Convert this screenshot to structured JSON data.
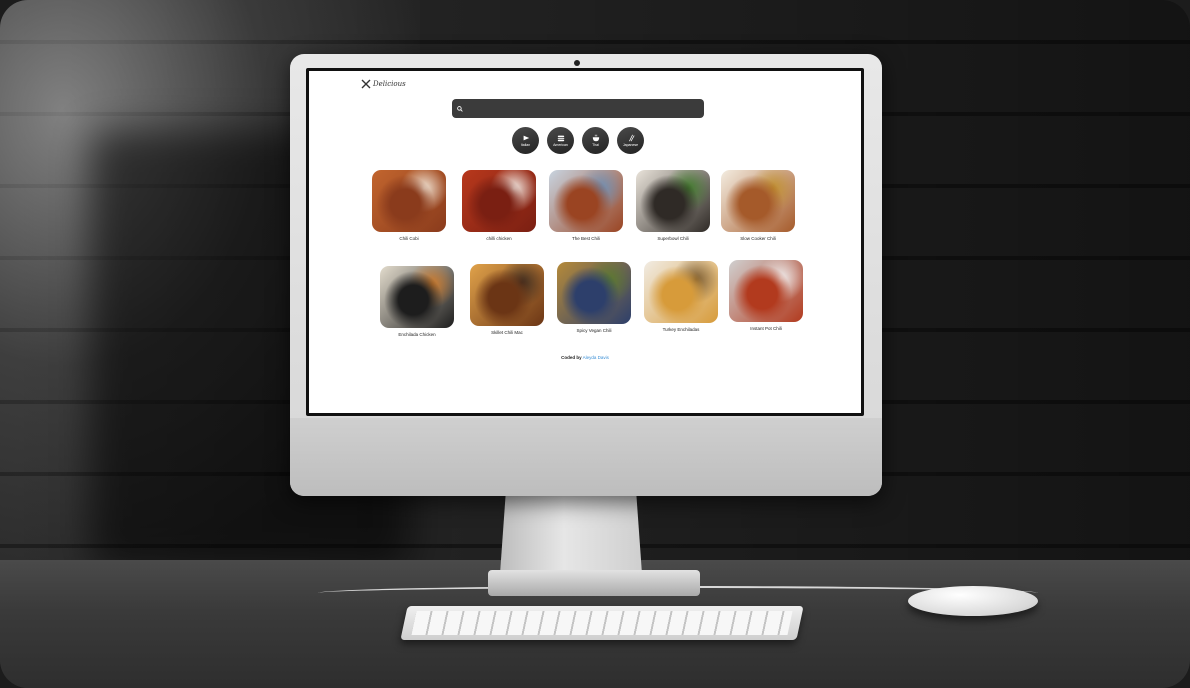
{
  "site": {
    "logo_text": "Delicious",
    "search_value": ""
  },
  "cuisines": [
    {
      "label": "Italian",
      "icon": "pizza-icon"
    },
    {
      "label": "American",
      "icon": "burger-icon"
    },
    {
      "label": "Thai",
      "icon": "bowl-icon"
    },
    {
      "label": "Japanese",
      "icon": "chopsticks-icon"
    }
  ],
  "recipes_row1": [
    {
      "name": "Chili Cobi",
      "colors": [
        "#8a3b1c",
        "#c2652e",
        "#f2e8da"
      ]
    },
    {
      "name": "chilli chicken",
      "colors": [
        "#7a1f12",
        "#b8381c",
        "#f4f0ea"
      ]
    },
    {
      "name": "The Best Chili",
      "colors": [
        "#9a4422",
        "#c8d4e0",
        "#6d8fb5"
      ]
    },
    {
      "name": "Superbowl Chili",
      "colors": [
        "#2f2a26",
        "#e9e3da",
        "#3f7a2a"
      ]
    },
    {
      "name": "Slow Cooker Chili",
      "colors": [
        "#a55a2a",
        "#f3ece0",
        "#c0902e"
      ]
    }
  ],
  "recipes_row2": [
    {
      "name": "Enchilada Chicken",
      "colors": [
        "#1d1d1d",
        "#e3dccd",
        "#d07b2a"
      ]
    },
    {
      "name": "Skillet Chili Mac",
      "colors": [
        "#6b3515",
        "#e0a24a",
        "#3b2a1f"
      ]
    },
    {
      "name": "Spicy Vegan Chili",
      "colors": [
        "#2d3f6b",
        "#b58a3a",
        "#5b7a2e"
      ]
    },
    {
      "name": "Turkey Enchiladas",
      "colors": [
        "#d79b3a",
        "#f1ece4",
        "#7a5a2e"
      ]
    },
    {
      "name": "Instant Pot Chili",
      "colors": [
        "#b23a1e",
        "#d0d0d0",
        "#f2f2f2"
      ]
    }
  ],
  "footer": {
    "prefix": "Coded by",
    "author": "Aleyda Davis"
  }
}
